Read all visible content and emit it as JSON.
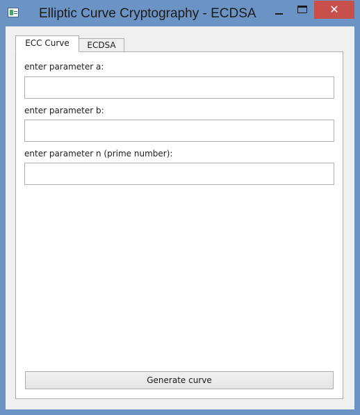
{
  "window": {
    "title": "Elliptic Curve Cryptography - ECDSA",
    "controls": {
      "minimize": "minimize",
      "maximize": "maximize",
      "close": "✕"
    }
  },
  "tabs": [
    {
      "label": "ECC Curve",
      "active": true
    },
    {
      "label": "ECDSA",
      "active": false
    }
  ],
  "form": {
    "param_a_label": "enter parameter a:",
    "param_a_value": "",
    "param_b_label": "enter parameter b:",
    "param_b_value": "",
    "param_n_label": "enter parameter n (prime number):",
    "param_n_value": "",
    "generate_label": "Generate curve"
  },
  "colors": {
    "frame": "#6b93c4",
    "close_button": "#c7504b",
    "client_bg": "#f0f0f0"
  }
}
